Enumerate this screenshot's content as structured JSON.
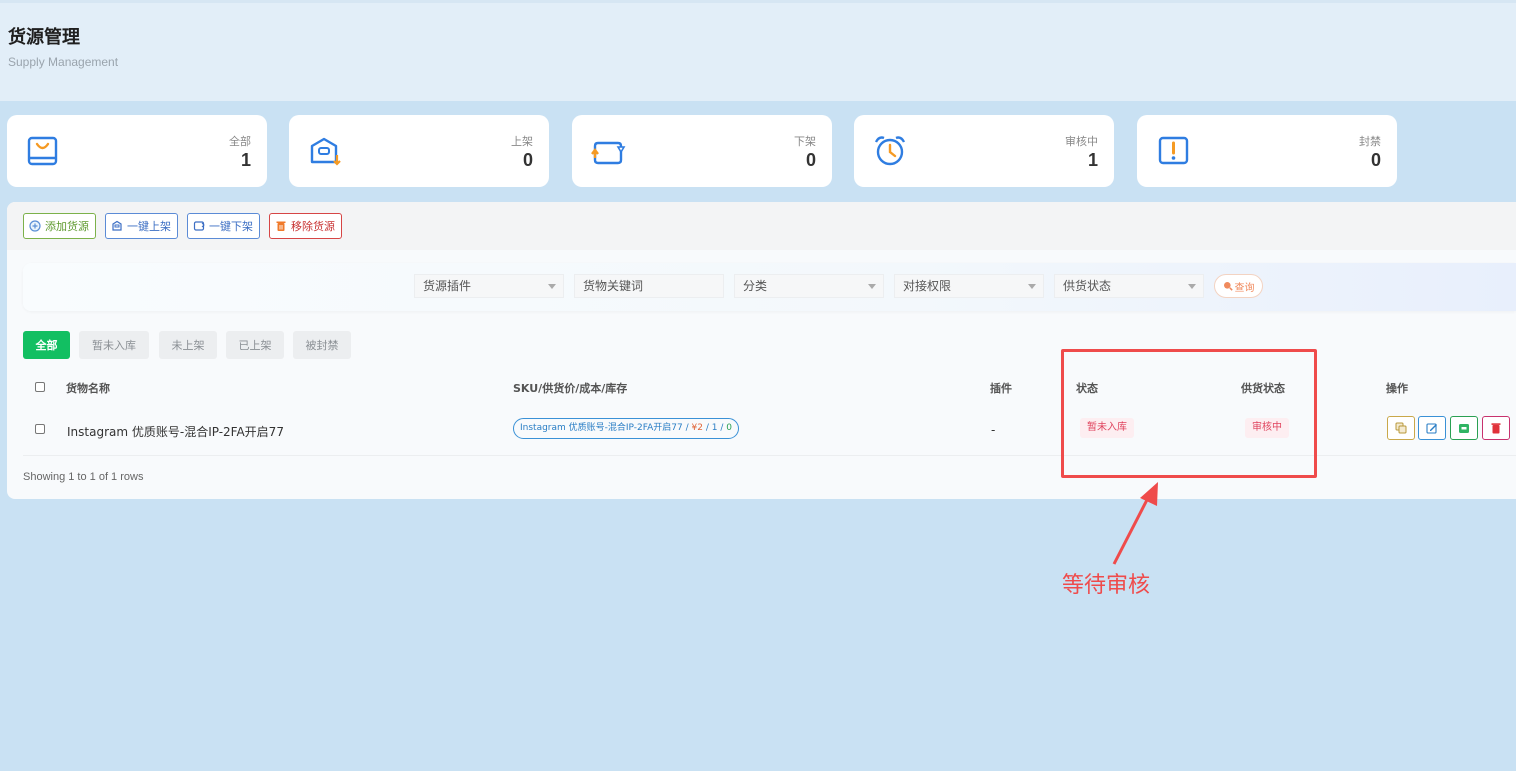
{
  "header": {
    "title": "货源管理",
    "subtitle": "Supply Management"
  },
  "stats": [
    {
      "label": "全部",
      "value": "1",
      "icon": "bag-icon"
    },
    {
      "label": "上架",
      "value": "0",
      "icon": "box-up-icon"
    },
    {
      "label": "下架",
      "value": "0",
      "icon": "box-down-icon"
    },
    {
      "label": "审核中",
      "value": "1",
      "icon": "alarm-clock-icon"
    },
    {
      "label": "封禁",
      "value": "0",
      "icon": "warning-icon"
    }
  ],
  "toolbar": {
    "add": "添加货源",
    "shelve_all": "一键上架",
    "unshelve_all": "一键下架",
    "remove": "移除货源"
  },
  "filters": {
    "plugin": "货源插件",
    "keyword": "货物关键词",
    "category": "分类",
    "permission": "对接权限",
    "supply_status": "供货状态",
    "query": "查询"
  },
  "tabs": [
    "全部",
    "暂未入库",
    "未上架",
    "已上架",
    "被封禁"
  ],
  "table": {
    "headers": {
      "name": "货物名称",
      "sku": "SKU/供货价/成本/库存",
      "plugin": "插件",
      "status": "状态",
      "supply_status": "供货状态",
      "actions": "操作"
    },
    "rows": [
      {
        "name": "Instagram 优质账号-混合IP-2FA开启77",
        "sku_name": "Instagram 优质账号-混合IP-2FA开启77",
        "price": "¥2",
        "cost": "1",
        "stock": "0",
        "plugin": "-",
        "status": "暂未入库",
        "supply_status": "审核中"
      }
    ]
  },
  "footer": "Showing 1 to 1 of 1 rows",
  "annotation": "等待审核",
  "colors": {
    "accent_green": "#12bf62",
    "annotation_red": "#ef4b4b",
    "badge_red": "#e0445e"
  }
}
